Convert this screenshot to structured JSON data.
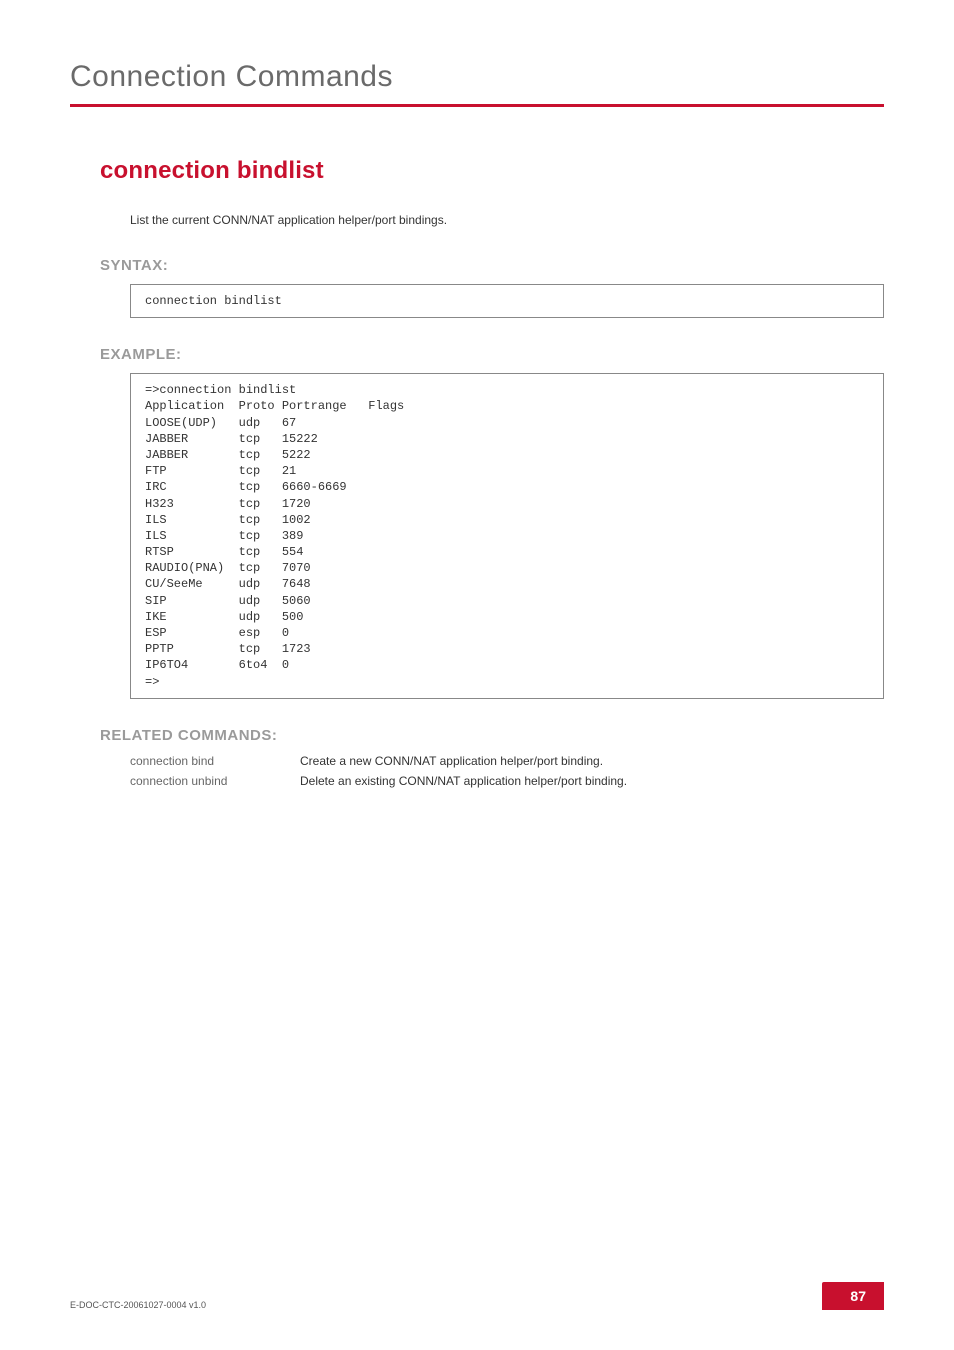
{
  "chapter": "Connection Commands",
  "command_title": "connection bindlist",
  "description": "List the current CONN/NAT application helper/port bindings.",
  "sections": {
    "syntax_label": "SYNTAX:",
    "example_label": "EXAMPLE:",
    "related_label": "RELATED COMMANDS:"
  },
  "syntax_code": "connection bindlist",
  "example_code": "=>connection bindlist\nApplication  Proto Portrange   Flags\nLOOSE(UDP)   udp   67\nJABBER       tcp   15222\nJABBER       tcp   5222\nFTP          tcp   21\nIRC          tcp   6660-6669\nH323         tcp   1720\nILS          tcp   1002\nILS          tcp   389\nRTSP         tcp   554\nRAUDIO(PNA)  tcp   7070\nCU/SeeMe     udp   7648\nSIP          udp   5060\nIKE          udp   500\nESP          esp   0\nPPTP         tcp   1723\nIP6TO4       6to4  0\n=>",
  "related": [
    {
      "cmd": "connection bind",
      "desc": "Create a new CONN/NAT application helper/port binding."
    },
    {
      "cmd": "connection unbind",
      "desc": "Delete an existing CONN/NAT application helper/port binding."
    }
  ],
  "footer": {
    "doc_id": "E-DOC-CTC-20061027-0004 v1.0",
    "page_number": "87"
  },
  "chart_data": {
    "type": "table",
    "title": "connection bindlist output",
    "columns": [
      "Application",
      "Proto",
      "Portrange",
      "Flags"
    ],
    "rows": [
      [
        "LOOSE(UDP)",
        "udp",
        "67",
        ""
      ],
      [
        "JABBER",
        "tcp",
        "15222",
        ""
      ],
      [
        "JABBER",
        "tcp",
        "5222",
        ""
      ],
      [
        "FTP",
        "tcp",
        "21",
        ""
      ],
      [
        "IRC",
        "tcp",
        "6660-6669",
        ""
      ],
      [
        "H323",
        "tcp",
        "1720",
        ""
      ],
      [
        "ILS",
        "tcp",
        "1002",
        ""
      ],
      [
        "ILS",
        "tcp",
        "389",
        ""
      ],
      [
        "RTSP",
        "tcp",
        "554",
        ""
      ],
      [
        "RAUDIO(PNA)",
        "tcp",
        "7070",
        ""
      ],
      [
        "CU/SeeMe",
        "udp",
        "7648",
        ""
      ],
      [
        "SIP",
        "udp",
        "5060",
        ""
      ],
      [
        "IKE",
        "udp",
        "500",
        ""
      ],
      [
        "ESP",
        "esp",
        "0",
        ""
      ],
      [
        "PPTP",
        "tcp",
        "1723",
        ""
      ],
      [
        "IP6TO4",
        "6to4",
        "0",
        ""
      ]
    ]
  }
}
